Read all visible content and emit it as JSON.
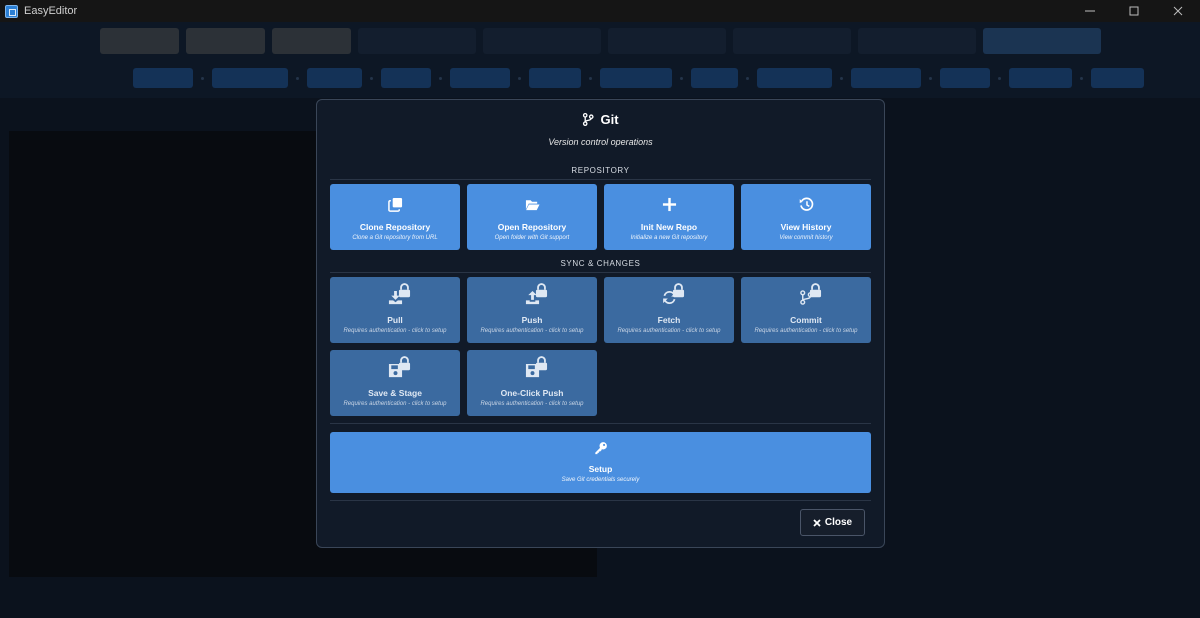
{
  "window": {
    "title": "EasyEditor"
  },
  "modal": {
    "title": "Git",
    "subtitle": "Version control operations",
    "sections": {
      "repository": "REPOSITORY",
      "sync": "SYNC & CHANGES"
    },
    "repository": [
      {
        "label": "Clone Repository",
        "desc": "Clone a Git repository from URL",
        "icon": "clone-icon"
      },
      {
        "label": "Open Repository",
        "desc": "Open folder with Git support",
        "icon": "folder-open-icon"
      },
      {
        "label": "Init New Repo",
        "desc": "Initialize a new Git repository",
        "icon": "plus-icon"
      },
      {
        "label": "View History",
        "desc": "View commit history",
        "icon": "history-icon"
      }
    ],
    "sync": [
      {
        "label": "Pull",
        "desc": "Requires authentication - click to setup",
        "icon": "download-icon"
      },
      {
        "label": "Push",
        "desc": "Requires authentication - click to setup",
        "icon": "upload-icon"
      },
      {
        "label": "Fetch",
        "desc": "Requires authentication - click to setup",
        "icon": "sync-icon"
      },
      {
        "label": "Commit",
        "desc": "Requires authentication - click to setup",
        "icon": "code-branch-icon"
      },
      {
        "label": "Save & Stage",
        "desc": "Requires authentication - click to setup",
        "icon": "save-icon"
      },
      {
        "label": "One-Click Push",
        "desc": "Requires authentication - click to setup",
        "icon": "save-icon"
      }
    ],
    "setup": {
      "label": "Setup",
      "desc": "Save Git credentials securely",
      "icon": "key-icon"
    },
    "close_label": "Close"
  },
  "colors": {
    "primary": "#4a8fe0",
    "locked": "#3b6aa0",
    "modal_bg": "#111a28",
    "page_bg": "#0b121d"
  }
}
